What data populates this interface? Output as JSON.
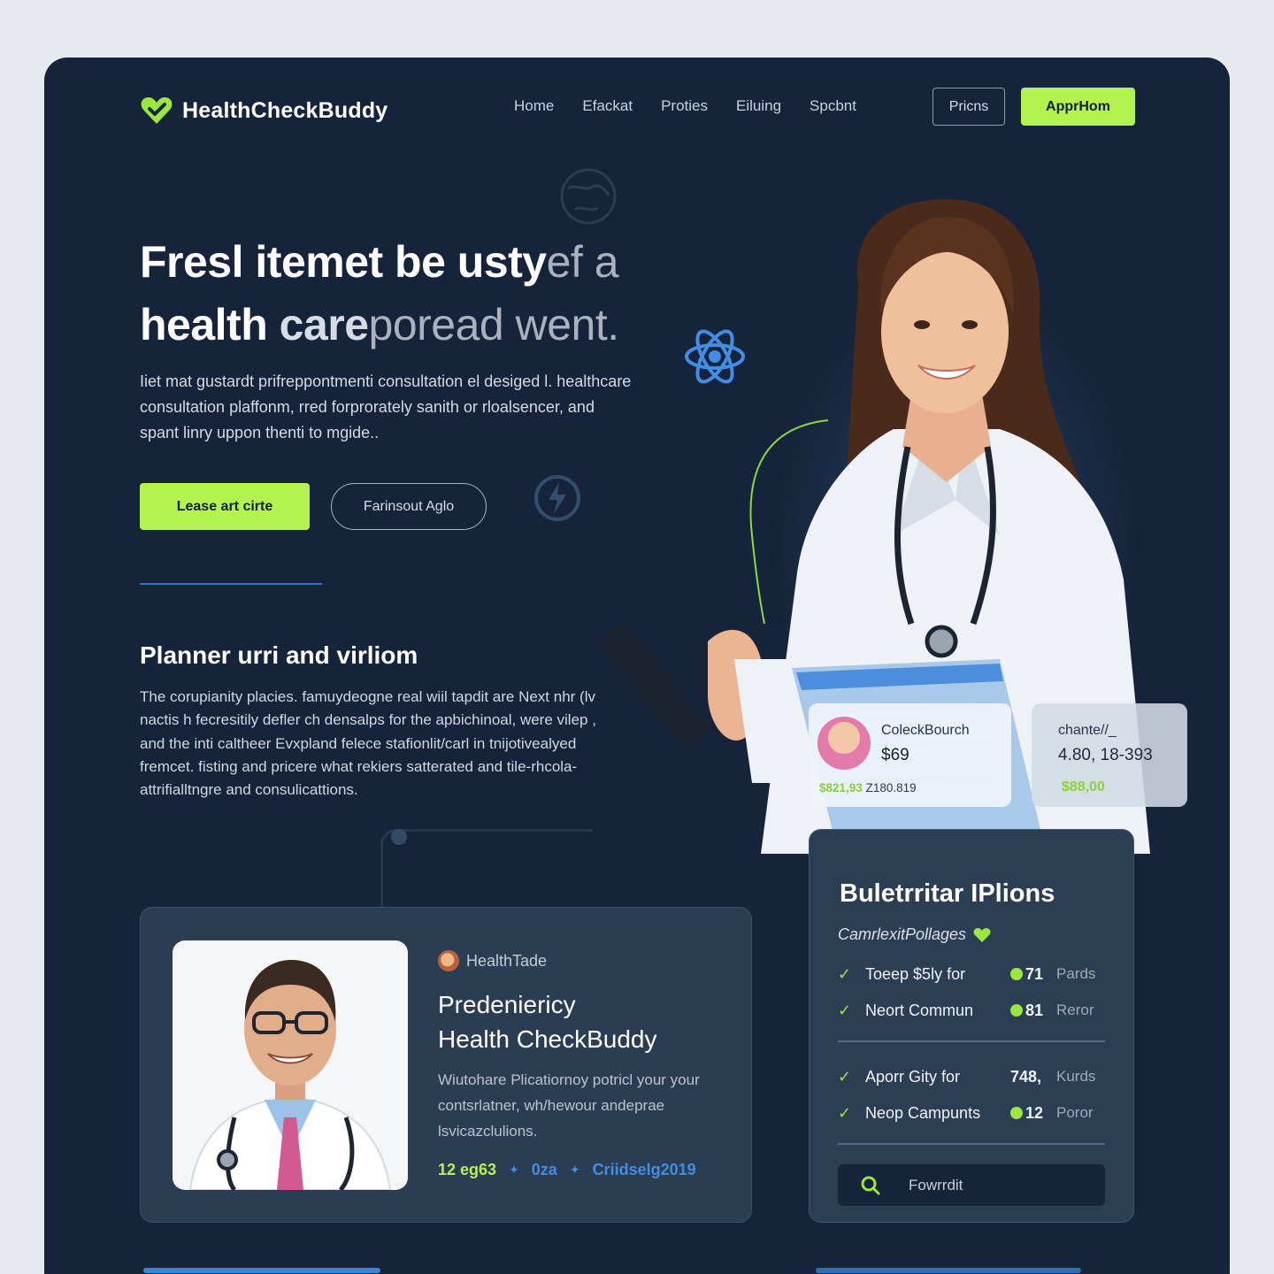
{
  "brand": {
    "name": "HealthCheckBuddy"
  },
  "nav": {
    "items": [
      "Home",
      "Efackat",
      "Proties",
      "Eiluing",
      "Spcbnt"
    ],
    "pricing_label": "Pricns",
    "app_label": "ApprHom"
  },
  "hero": {
    "title_line1_bold": "Fresl itemet be usty",
    "title_line1_dim": "ef a",
    "title_line2_bold": "health ",
    "title_line2_mid": "care",
    "title_line2_dim": "poread went.",
    "description": "Iiet mat gustardt prifreppontmenti consultation el desiged l. healthcare consultation plaffonm, rred forprorately sanith or rloalsencer, and spant linry uppon thenti to mgide..",
    "primary_button": "Lease art cirte",
    "secondary_button": "Farinsout Aglo"
  },
  "section": {
    "title": "Planner urri and virliom",
    "description": "The corupianity placies. famuydeogne real wiil tapdit are Next nhr (lv nactis h fecresitily defler ch densalps for the apbichinoal, were vilep , and the inti caltheer Evxpland felece stafionlit/carl in tnijotivealyed fremcet. fisting and pricere what rekiers satterated and tile-rhcola-attrifialltngre and consulicattions."
  },
  "price_cards": [
    {
      "name": "ColeckBourch",
      "price": "$69",
      "meta_highlight": "$821,93",
      "meta_rest": "Z180.819"
    },
    {
      "name": "chante//_",
      "value": "4.80, 18-393",
      "price": "$88,00"
    }
  ],
  "profile": {
    "brand_tag": "HealthTade",
    "title_line1": "Predeniericy",
    "title_line2": "Health CheckBuddy",
    "description": "Wiutohare Plicatiornoy potricl your your contsrlatner, wh/hewour andeprae lsvicazclulions.",
    "stats": [
      "12 eg63",
      "0za",
      "Criidselg2019"
    ]
  },
  "plans": {
    "title": "Buletrritar IPlions",
    "subtitle": "CamrlexitPollages",
    "rows": [
      {
        "label": "Toeep $5ly for",
        "num": "71",
        "unit": "Pards",
        "dot": true
      },
      {
        "label": "Neort Commun",
        "num": "81",
        "unit": "Reror",
        "dot": true
      },
      {
        "label": "Aporr Gity for",
        "num": "748,",
        "unit": "Kurds",
        "dot": false
      },
      {
        "label": "Neop Campunts",
        "num": "12",
        "unit": "Poror",
        "dot": true
      }
    ],
    "search_placeholder": "Fowrrdit"
  },
  "colors": {
    "background": "#15243a",
    "accent": "#b4f24f",
    "link_blue": "#3f8fe6",
    "card": "#2b3d53"
  },
  "icons": [
    "heart-logo-icon",
    "atom-icon",
    "lightning-icon",
    "globe-icon",
    "check-icon",
    "heart-icon",
    "search-icon"
  ]
}
